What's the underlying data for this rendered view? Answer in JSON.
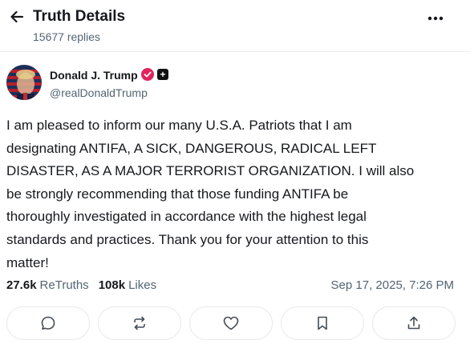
{
  "header": {
    "title": "Truth Details",
    "subtitle": "15677 replies",
    "back_icon": "arrow-left-icon",
    "more_icon": "ellipsis-icon"
  },
  "author": {
    "name": "Donald J. Trump",
    "handle": "@realDonaldTrump",
    "verified_icon": "verified-badge-icon",
    "plus_badge": "+"
  },
  "post": {
    "lines": [
      "I am pleased to inform our many U.S.A. Patriots that I am",
      "designating ANTIFA, A SICK, DANGEROUS, RADICAL LEFT",
      "DISASTER, AS A MAJOR TERRORIST ORGANIZATION. I will also",
      "be strongly recommending that those funding ANTIFA be",
      "thoroughly investigated in accordance with the highest legal",
      "standards and practices. Thank you for your attention to this",
      "matter!"
    ],
    "retruths_count": "27.6k",
    "retruths_label": "ReTruths",
    "likes_count": "108k",
    "likes_label": "Likes",
    "timestamp": "Sep 17, 2025, 7:26 PM"
  },
  "actions": [
    {
      "name": "reply",
      "icon": "comment-icon"
    },
    {
      "name": "retruth",
      "icon": "repost-icon"
    },
    {
      "name": "like",
      "icon": "heart-icon"
    },
    {
      "name": "bookmark",
      "icon": "bookmark-icon"
    },
    {
      "name": "share",
      "icon": "share-icon"
    }
  ],
  "colors": {
    "text": "#16181c",
    "muted": "#536471",
    "verified": "#e0245e",
    "border": "#e6e9ec"
  }
}
